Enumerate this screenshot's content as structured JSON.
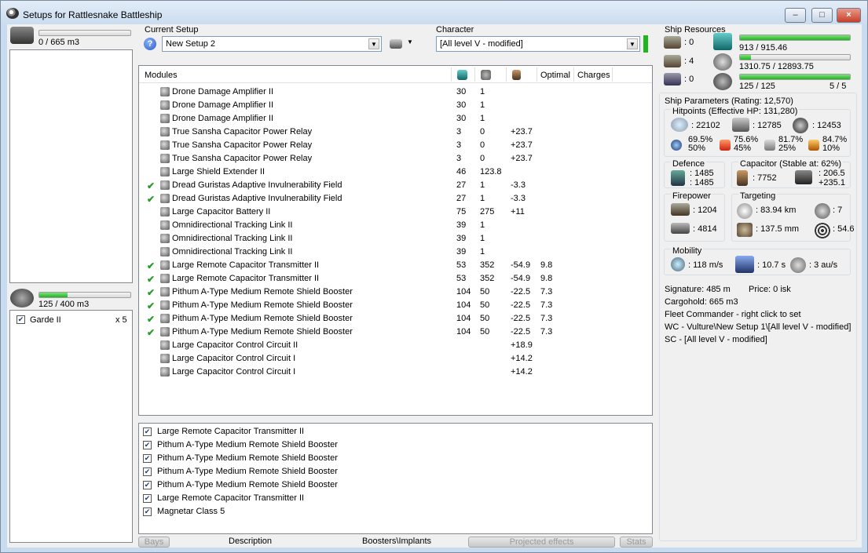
{
  "window": {
    "title": "Setups for Rattlesnake Battleship",
    "min_label": "–",
    "max_label": "□",
    "close_label": "×"
  },
  "left": {
    "cargo_usage": "0 / 665 m3",
    "cargo_fill": 0.0,
    "drone_usage": "125 / 400 m3",
    "drone_fill": 0.3125,
    "drones": [
      {
        "name": "Garde II",
        "count": "x 5",
        "checked": true
      }
    ]
  },
  "setup": {
    "label": "Current Setup",
    "value": "New Setup 2"
  },
  "character": {
    "label": "Character",
    "value": "[All level V - modified]"
  },
  "modules": {
    "headers": {
      "name": "Modules",
      "optimal": "Optimal",
      "charges": "Charges"
    },
    "rows": [
      {
        "check": "",
        "name": "Drone Damage Amplifier II",
        "cpu": "30",
        "pg": "1",
        "cap": "",
        "optimal": "",
        "icon": "drone-damage-amplifier-icon"
      },
      {
        "check": "",
        "name": "Drone Damage Amplifier II",
        "cpu": "30",
        "pg": "1",
        "cap": "",
        "optimal": "",
        "icon": "drone-damage-amplifier-icon"
      },
      {
        "check": "",
        "name": "Drone Damage Amplifier II",
        "cpu": "30",
        "pg": "1",
        "cap": "",
        "optimal": "",
        "icon": "drone-damage-amplifier-icon"
      },
      {
        "check": "",
        "name": "True Sansha Capacitor Power Relay",
        "cpu": "3",
        "pg": "0",
        "cap": "+23.7",
        "optimal": "",
        "icon": "capacitor-power-relay-icon"
      },
      {
        "check": "",
        "name": "True Sansha Capacitor Power Relay",
        "cpu": "3",
        "pg": "0",
        "cap": "+23.7",
        "optimal": "",
        "icon": "capacitor-power-relay-icon"
      },
      {
        "check": "",
        "name": "True Sansha Capacitor Power Relay",
        "cpu": "3",
        "pg": "0",
        "cap": "+23.7",
        "optimal": "",
        "icon": "capacitor-power-relay-icon"
      },
      {
        "check": "",
        "name": "Large Shield Extender II",
        "cpu": "46",
        "pg": "123.8",
        "cap": "",
        "optimal": "",
        "icon": "shield-extender-icon"
      },
      {
        "check": "✔",
        "name": "Dread Guristas Adaptive Invulnerability Field",
        "cpu": "27",
        "pg": "1",
        "cap": "-3.3",
        "optimal": "",
        "icon": "invulnerability-field-icon"
      },
      {
        "check": "✔",
        "name": "Dread Guristas Adaptive Invulnerability Field",
        "cpu": "27",
        "pg": "1",
        "cap": "-3.3",
        "optimal": "",
        "icon": "invulnerability-field-icon"
      },
      {
        "check": "",
        "name": "Large Capacitor Battery II",
        "cpu": "75",
        "pg": "275",
        "cap": "+11",
        "optimal": "",
        "icon": "capacitor-battery-icon"
      },
      {
        "check": "",
        "name": "Omnidirectional Tracking Link II",
        "cpu": "39",
        "pg": "1",
        "cap": "",
        "optimal": "",
        "icon": "tracking-link-icon"
      },
      {
        "check": "",
        "name": "Omnidirectional Tracking Link II",
        "cpu": "39",
        "pg": "1",
        "cap": "",
        "optimal": "",
        "icon": "tracking-link-icon"
      },
      {
        "check": "",
        "name": "Omnidirectional Tracking Link II",
        "cpu": "39",
        "pg": "1",
        "cap": "",
        "optimal": "",
        "icon": "tracking-link-icon"
      },
      {
        "check": "✔",
        "name": "Large Remote Capacitor Transmitter II",
        "cpu": "53",
        "pg": "352",
        "cap": "-54.9",
        "optimal": "9.8",
        "icon": "capacitor-transmitter-icon"
      },
      {
        "check": "✔",
        "name": "Large Remote Capacitor Transmitter II",
        "cpu": "53",
        "pg": "352",
        "cap": "-54.9",
        "optimal": "9.8",
        "icon": "capacitor-transmitter-icon"
      },
      {
        "check": "✔",
        "name": "Pithum A-Type Medium Remote Shield Booster",
        "cpu": "104",
        "pg": "50",
        "cap": "-22.5",
        "optimal": "7.3",
        "icon": "remote-shield-booster-icon"
      },
      {
        "check": "✔",
        "name": "Pithum A-Type Medium Remote Shield Booster",
        "cpu": "104",
        "pg": "50",
        "cap": "-22.5",
        "optimal": "7.3",
        "icon": "remote-shield-booster-icon"
      },
      {
        "check": "✔",
        "name": "Pithum A-Type Medium Remote Shield Booster",
        "cpu": "104",
        "pg": "50",
        "cap": "-22.5",
        "optimal": "7.3",
        "icon": "remote-shield-booster-icon"
      },
      {
        "check": "✔",
        "name": "Pithum A-Type Medium Remote Shield Booster",
        "cpu": "104",
        "pg": "50",
        "cap": "-22.5",
        "optimal": "7.3",
        "icon": "remote-shield-booster-icon"
      },
      {
        "check": "",
        "name": "Large Capacitor Control Circuit II",
        "cpu": "",
        "pg": "",
        "cap": "+18.9",
        "optimal": "",
        "icon": "capacitor-control-circuit-icon"
      },
      {
        "check": "",
        "name": "Large Capacitor Control Circuit I",
        "cpu": "",
        "pg": "",
        "cap": "+14.2",
        "optimal": "",
        "icon": "capacitor-control-circuit-icon"
      },
      {
        "check": "",
        "name": "Large Capacitor Control Circuit I",
        "cpu": "",
        "pg": "",
        "cap": "+14.2",
        "optimal": "",
        "icon": "capacitor-control-circuit-icon"
      }
    ]
  },
  "projected": [
    "Large Remote Capacitor Transmitter II",
    "Pithum A-Type Medium Remote Shield Booster",
    "Pithum A-Type Medium Remote Shield Booster",
    "Pithum A-Type Medium Remote Shield Booster",
    "Pithum A-Type Medium Remote Shield Booster",
    "Large Remote Capacitor Transmitter II",
    "Magnetar Class 5"
  ],
  "tabs": {
    "bays": "Bays",
    "description": "Description",
    "boosters": "Boosters\\Implants",
    "projected": "Projected effects",
    "stats": "Stats"
  },
  "resources": {
    "title": "Ship Resources",
    "turret_slots": ": 0",
    "launcher_slots": ": 4",
    "rig_slots": ": 0",
    "cpu": "913 / 915.46",
    "cpu_fill": 0.997,
    "powergrid": "1310.75 / 12893.75",
    "powergrid_fill": 0.102,
    "drone_bandwidth": "125 / 125",
    "drones_active": "5 / 5",
    "drone_bw_fill": 1.0
  },
  "params": {
    "title": "Ship Parameters (Rating: 12,570)",
    "hitpoints_title": "Hitpoints (Effective HP: 131,280)",
    "shield_hp": ": 22102",
    "armor_hp": ": 12785",
    "structure_hp": ": 12453",
    "em_res": "69.5%",
    "em_res2": "50%",
    "thermal_res": "75.6%",
    "thermal_res2": "45%",
    "kinetic_res": "81.7%",
    "kinetic_res2": "25%",
    "explosive_res": "84.7%",
    "explosive_res2": "10%",
    "defence_title": "Defence",
    "defence_1": ": 1485",
    "defence_2": ": 1485",
    "capacitor_title": "Capacitor (Stable at: 62%)",
    "capacitor_amount": ": 7752",
    "capacitor_rate1": ": 206.5",
    "capacitor_rate2": "+235.1",
    "firepower_title": "Firepower",
    "firepower_1": ": 1204",
    "firepower_2": ": 4814",
    "targeting_title": "Targeting",
    "target_range": ": 83.94 km",
    "max_targets": ": 7",
    "scan_resolution": ": 137.5 mm",
    "sensor_strength": ": 54.6",
    "mobility_title": "Mobility",
    "velocity": ": 118 m/s",
    "align_time": ": 10.7 s",
    "warp_speed": ": 3 au/s",
    "signature": "Signature: 485 m",
    "price": "Price: 0 isk",
    "cargohold": "Cargohold: 665 m3",
    "fleet_commander": "Fleet Commander - right click to set",
    "wc": "WC - Vulture\\New Setup 1\\[All level V - modified]",
    "sc": "SC - [All level V - modified]"
  },
  "colors": {
    "accent_green": "#1fb51f",
    "check_green": "#2a9a2a"
  }
}
